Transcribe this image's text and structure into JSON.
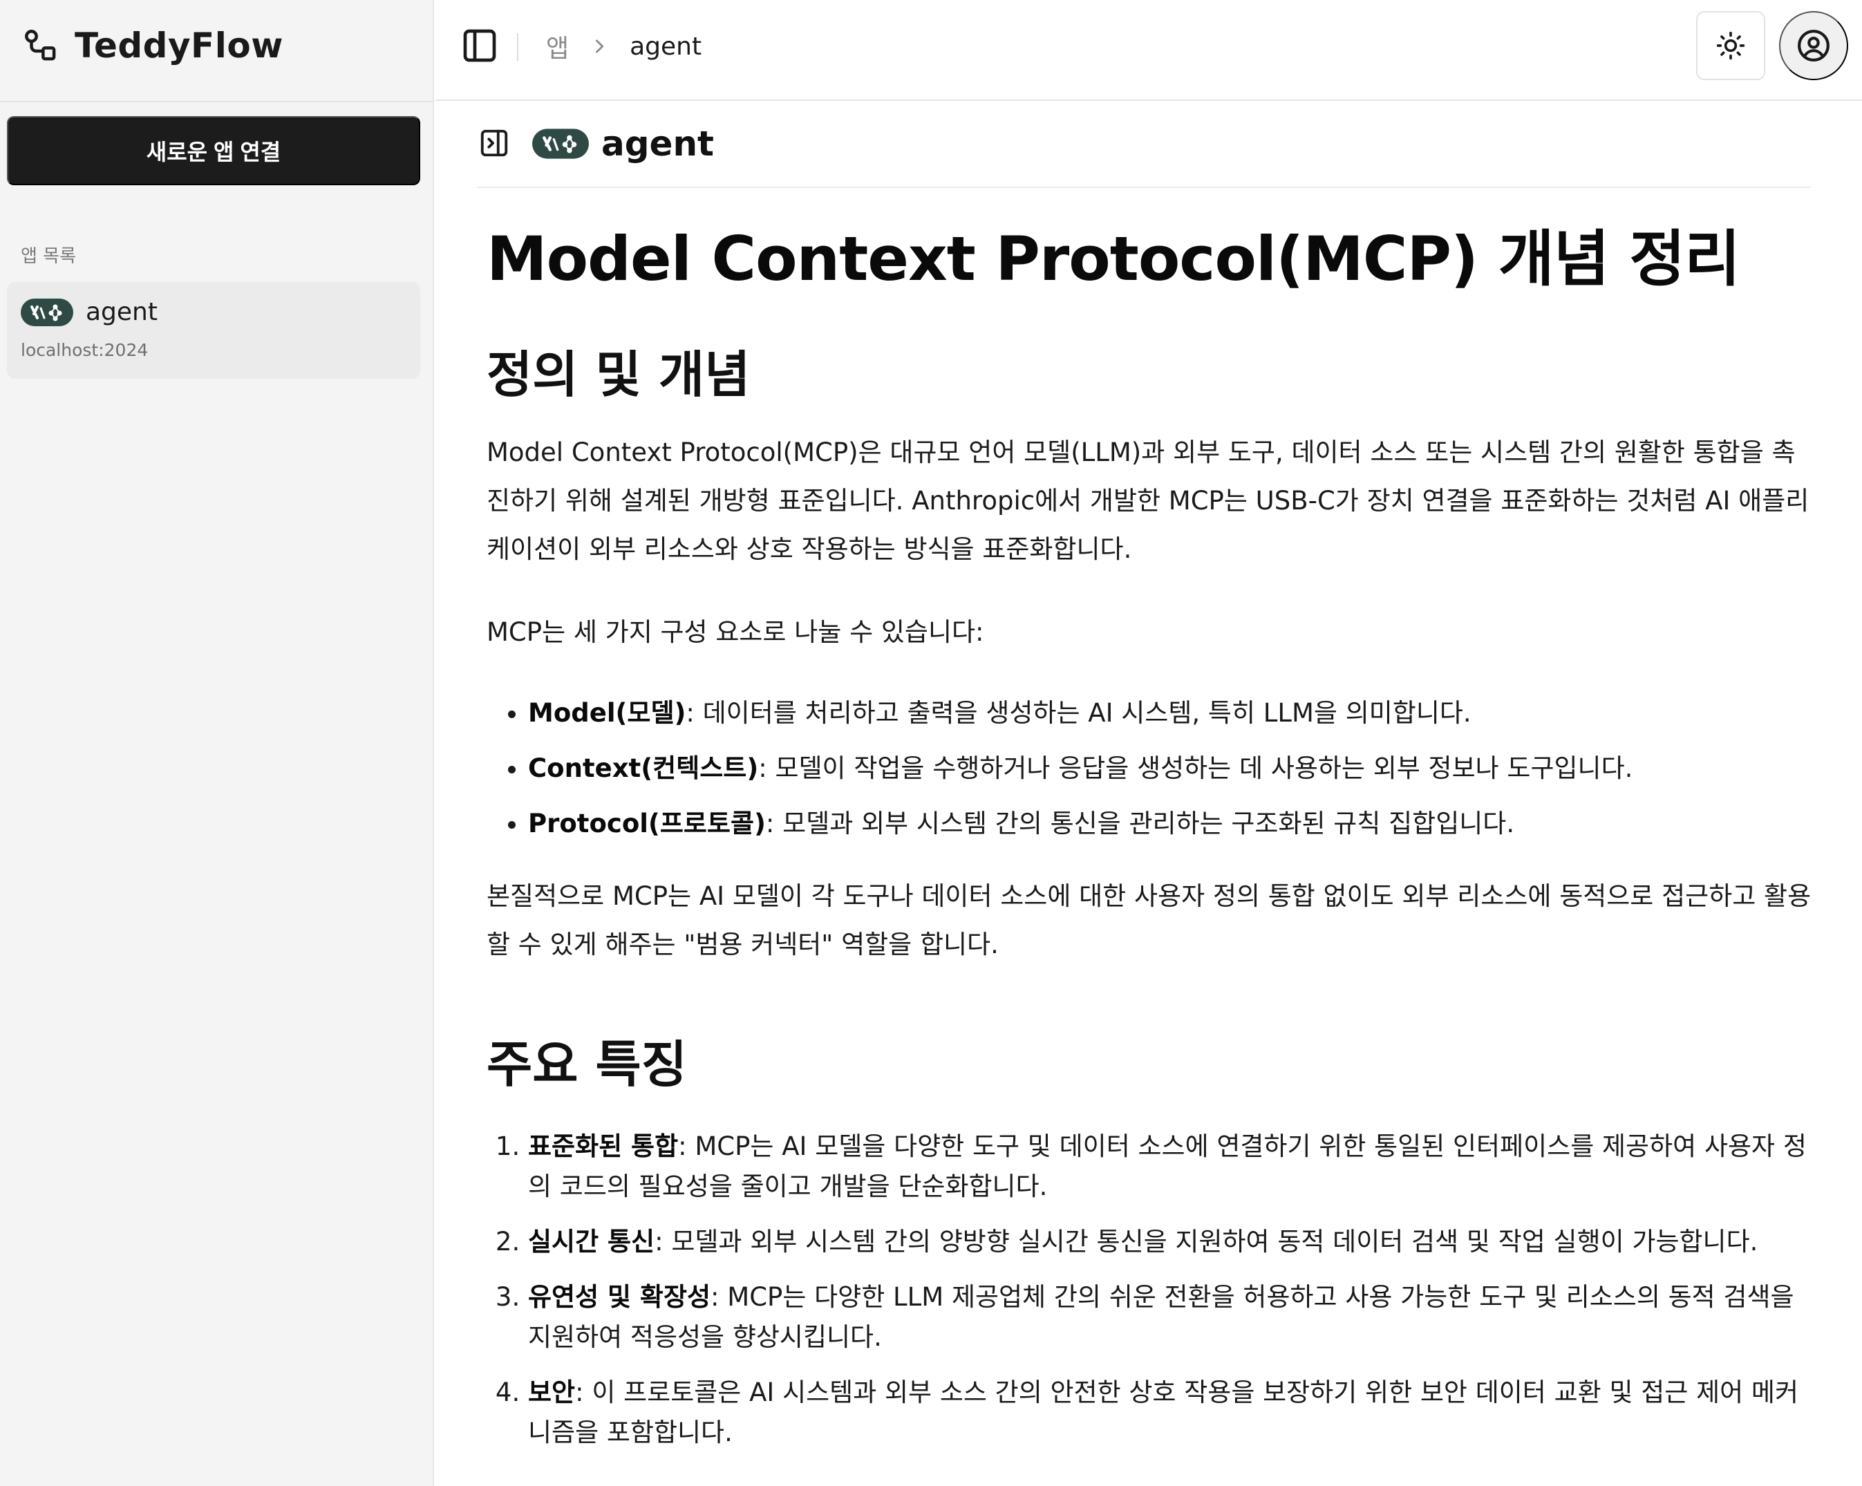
{
  "sidebar": {
    "brand": "TeddyFlow",
    "new_app_button": "새로운 앱 연결",
    "app_list_label": "앱 목록",
    "apps": [
      {
        "name": "agent",
        "host": "localhost:2024"
      }
    ]
  },
  "topbar": {
    "breadcrumb_root": "앱",
    "breadcrumb_current": "agent"
  },
  "content_header": {
    "title": "agent"
  },
  "document": {
    "title": "Model Context Protocol(MCP) 개념 정리",
    "section1": {
      "heading": "정의 및 개념",
      "para1": "Model Context Protocol(MCP)은 대규모 언어 모델(LLM)과 외부 도구, 데이터 소스 또는 시스템 간의 원활한 통합을 촉진하기 위해 설계된 개방형 표준입니다. Anthropic에서 개발한 MCP는 USB-C가 장치 연결을 표준화하는 것처럼 AI 애플리케이션이 외부 리소스와 상호 작용하는 방식을 표준화합니다.",
      "para2": "MCP는 세 가지 구성 요소로 나눌 수 있습니다:",
      "bullets": [
        {
          "term": "Model(모델)",
          "text": ": 데이터를 처리하고 출력을 생성하는 AI 시스템, 특히 LLM을 의미합니다."
        },
        {
          "term": "Context(컨텍스트)",
          "text": ": 모델이 작업을 수행하거나 응답을 생성하는 데 사용하는 외부 정보나 도구입니다."
        },
        {
          "term": "Protocol(프로토콜)",
          "text": ": 모델과 외부 시스템 간의 통신을 관리하는 구조화된 규칙 집합입니다."
        }
      ],
      "para3": "본질적으로 MCP는 AI 모델이 각 도구나 데이터 소스에 대한 사용자 정의 통합 없이도 외부 리소스에 동적으로 접근하고 활용할 수 있게 해주는 \"범용 커넥터\" 역할을 합니다."
    },
    "section2": {
      "heading": "주요 특징",
      "items": [
        {
          "term": "표준화된 통합",
          "text": ": MCP는 AI 모델을 다양한 도구 및 데이터 소스에 연결하기 위한 통일된 인터페이스를 제공하여 사용자 정의 코드의 필요성을 줄이고 개발을 단순화합니다."
        },
        {
          "term": "실시간 통신",
          "text": ": 모델과 외부 시스템 간의 양방향 실시간 통신을 지원하여 동적 데이터 검색 및 작업 실행이 가능합니다."
        },
        {
          "term": "유연성 및 확장성",
          "text": ": MCP는 다양한 LLM 제공업체 간의 쉬운 전환을 허용하고 사용 가능한 도구 및 리소스의 동적 검색을 지원하여 적응성을 향상시킵니다."
        },
        {
          "term": "보안",
          "text": ": 이 프로토콜은 AI 시스템과 외부 소스 간의 안전한 상호 작용을 보장하기 위한 보안 데이터 교환 및 접근 제어 메커니즘을 포함합니다."
        }
      ]
    }
  },
  "icons": {
    "brand": "workflow-icon",
    "sidebar_toggle": "panel-left-icon",
    "breadcrumb_sep": "chevron-right-icon",
    "theme": "sun-icon",
    "user": "user-circle-icon",
    "panel": "panel-right-open-icon",
    "app_badge": "langgraph-badge-icon"
  },
  "colors": {
    "primary_button": "#1c1c1c",
    "sidebar_bg": "#f4f4f4",
    "badge_bg": "#2f4a45"
  }
}
